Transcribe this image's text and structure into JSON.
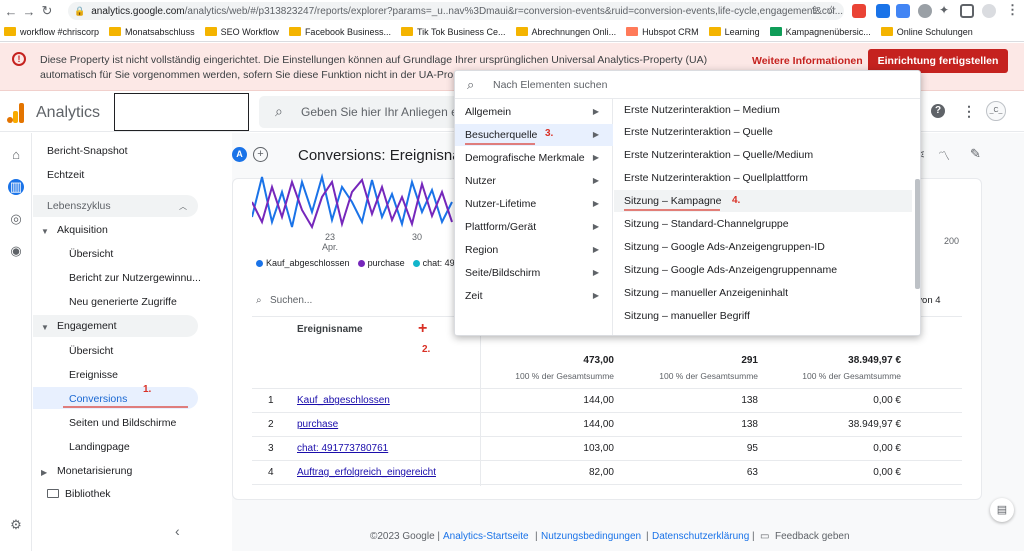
{
  "browser": {
    "url_host": "analytics.google.com",
    "url_path": "/analytics/web/#/p313823247/reports/explorer?params=_u..nav%3Dmaui&r=conversion-events&ruid=conversion-events,life-cycle,engagement&col...",
    "bookmarks": [
      "workflow #chriscorp",
      "Monatsabschluss",
      "SEO Workflow",
      "Facebook Business...",
      "Tik Tok Business Ce...",
      "Abrechnungen Onli...",
      "Hubspot CRM",
      "Learning",
      "Kampagnenübersic...",
      "Online Schulungen"
    ]
  },
  "banner": {
    "text": "Diese Property ist nicht vollständig eingerichtet. Die Einstellungen können auf Grundlage Ihrer ursprünglichen Universal Analytics-Property (UA) automatisch für Sie vorgenommen werden, sofern Sie diese Funktion nicht in der UA-Property deaktivieren.",
    "more_link": "Weitere Informationen",
    "action_button": "Einrichtung fertigstellen"
  },
  "header": {
    "app_name": "Analytics",
    "search_placeholder": "Geben Sie hier Ihr Anliegen ei",
    "avatar_text": "_C_"
  },
  "sidebar": {
    "items": {
      "snapshot": "Bericht-Snapshot",
      "realtime": "Echtzeit",
      "lifecycle": "Lebenszyklus",
      "acquisition": "Akquisition",
      "acq_overview": "Übersicht",
      "acq_user": "Bericht zur Nutzergewinnu...",
      "acq_traffic": "Neu generierte Zugriffe",
      "engagement": "Engagement",
      "eng_overview": "Übersicht",
      "eng_events": "Ereignisse",
      "eng_conversions": "Conversions",
      "eng_pages": "Seiten und Bildschirme",
      "eng_landing": "Landingpage",
      "monetization": "Monetarisierung",
      "library": "Bibliothek"
    }
  },
  "page": {
    "avatar_letter": "A",
    "title": "Conversions: Ereignisna",
    "chart_x_labels": [
      "23\nApr.",
      "30"
    ],
    "chart_x_label_23": "23",
    "chart_x_label_apr": "Apr.",
    "chart_x_label_30": "30",
    "chart_right_tick": "200",
    "legend": [
      "Kauf_abgeschlossen",
      "purchase",
      "chat: 491773"
    ],
    "legend_colors": [
      "#1a73e8",
      "#7627bb",
      "#12b5cb"
    ],
    "table_search_placeholder": "Suchen...",
    "pagination": "s 4 von 4",
    "col_header": "Ereignisname",
    "totals": {
      "c1": "473,00",
      "c1_sub": "100 % der Gesamtsumme",
      "c2": "291",
      "c2_sub": "100 % der Gesamtsumme",
      "c3": "38.949,97 €",
      "c3_sub": "100 % der Gesamtsumme"
    },
    "rows": [
      {
        "n": "1",
        "name": "Kauf_abgeschlossen",
        "v1": "144,00",
        "v2": "138",
        "v3": "0,00 €"
      },
      {
        "n": "2",
        "name": "purchase",
        "v1": "144,00",
        "v2": "138",
        "v3": "38.949,97 €"
      },
      {
        "n": "3",
        "name": "chat: 491773780761",
        "v1": "103,00",
        "v2": "95",
        "v3": "0,00 €"
      },
      {
        "n": "4",
        "name": "Auftrag_erfolgreich_eingereicht",
        "v1": "82,00",
        "v2": "63",
        "v3": "0,00 €"
      }
    ]
  },
  "dropdown": {
    "search_placeholder": "Nach Elementen suchen",
    "categories": [
      "Allgemein",
      "Besucherquelle",
      "Demografische Merkmale",
      "Nutzer",
      "Nutzer-Lifetime",
      "Plattform/Gerät",
      "Region",
      "Seite/Bildschirm",
      "Zeit"
    ],
    "items": [
      "Erste Nutzerinteraktion – Medium",
      "Erste Nutzerinteraktion – Quelle",
      "Erste Nutzerinteraktion – Quelle/Medium",
      "Erste Nutzerinteraktion – Quellplattform",
      "Sitzung – Kampagne",
      "Sitzung – Standard-Channelgruppe",
      "Sitzung – Google Ads-Anzeigengruppen-ID",
      "Sitzung – Google Ads-Anzeigengruppenname",
      "Sitzung – manueller Anzeigeninhalt",
      "Sitzung – manueller Begriff"
    ]
  },
  "annotations": {
    "a1": "1.",
    "a2": "2.",
    "a3": "3.",
    "a4": "4."
  },
  "footer": {
    "copyright": "©2023 Google |",
    "link1": "Analytics-Startseite",
    "sep1": "|",
    "link2": "Nutzungsbedingungen",
    "sep2": "|",
    "link3": "Datenschutzerklärung",
    "sep3": "|",
    "feedback": "Feedback geben"
  }
}
